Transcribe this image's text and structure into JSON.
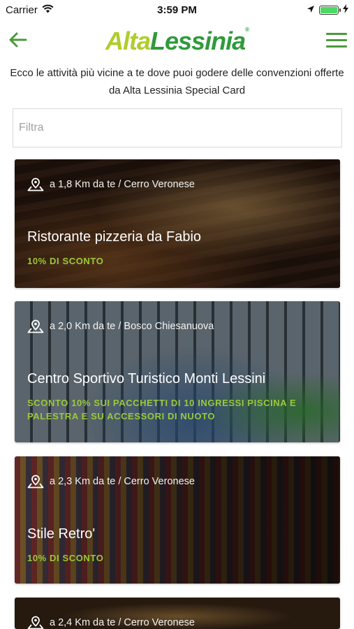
{
  "status_bar": {
    "carrier": "Carrier",
    "time": "3:59 PM",
    "battery_level": 1.0
  },
  "nav": {
    "logo_part1": "Alta",
    "logo_part2": "Lessinia",
    "logo_mark": "®",
    "back_icon": "arrow-left-icon",
    "menu_icon": "hamburger-menu-icon"
  },
  "intro": {
    "text": "Ecco le attività più vicine a te dove puoi godere delle convenzioni offerte da Alta Lessinia Special Card"
  },
  "filter": {
    "placeholder": "Filtra",
    "value": ""
  },
  "colors": {
    "accent_green": "#4a9a3b",
    "discount_green": "#9ac93a",
    "logo_light_green": "#b0cc2e",
    "logo_dark_green": "#2f9a3c"
  },
  "cards": [
    {
      "location": "a 1,8 Km da te / Cerro Veronese",
      "title": "Ristorante pizzeria da Fabio",
      "discount": "10% DI SCONTO"
    },
    {
      "location": "a 2,0 Km da te / Bosco Chiesanuova",
      "title": "Centro Sportivo Turistico Monti Lessini",
      "discount": "SCONTO 10% SUI PACCHETTI DI 10 INGRESSI PISCINA E PALESTRA E SU ACCESSORI DI NUOTO"
    },
    {
      "location": "a 2,3 Km da te / Cerro Veronese",
      "title": "Stile Retro'",
      "discount": "10% DI SCONTO"
    },
    {
      "location": "a 2,4 Km da te / Cerro Veronese",
      "title": "",
      "discount": ""
    }
  ]
}
